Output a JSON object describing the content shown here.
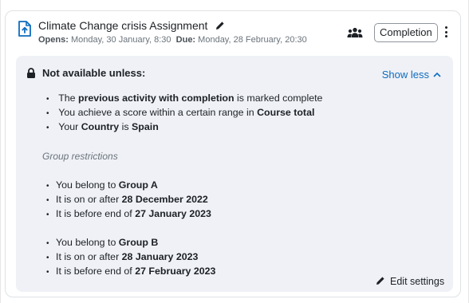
{
  "activity": {
    "title": "Climate Change crisis Assignment",
    "opens_label": "Opens:",
    "opens_value": "Monday, 30 January, 8:30",
    "due_label": "Due:",
    "due_value": "Monday, 28 February, 20:30",
    "icons": {
      "activity": "assignment-upload-icon",
      "edit": "pencil-icon",
      "group": "group-icon",
      "menu": "kebab-menu-icon"
    },
    "completion_label": "Completion"
  },
  "restrictions": {
    "title": "Not available unless:",
    "toggle_label": "Show less",
    "items": [
      {
        "pre": "The ",
        "bold": "previous activity with completion",
        "post": " is marked complete"
      },
      {
        "pre": "You achieve a score within a certain range in ",
        "bold": "Course total",
        "post": ""
      },
      {
        "pre": "Your ",
        "bold": "Country",
        "mid": " is ",
        "bold2": "Spain"
      }
    ],
    "group_heading": "Group restrictions",
    "groups": [
      {
        "items": [
          {
            "pre": "You belong to ",
            "bold": "Group A"
          },
          {
            "pre": "It is on or after ",
            "bold": "28 December 2022"
          },
          {
            "pre": "It is before end of ",
            "bold": "27 January 2023"
          }
        ]
      },
      {
        "items": [
          {
            "pre": "You belong to ",
            "bold": "Group B"
          },
          {
            "pre": "It is on or after ",
            "bold": "28 January 2023"
          },
          {
            "pre": "It is before end of ",
            "bold": "27 February 2023"
          }
        ]
      }
    ],
    "edit_label": "Edit settings"
  },
  "colors": {
    "link": "#0f6cbf",
    "panel_bg": "#eff1f6",
    "text": "#1d2125",
    "muted": "#6a737b"
  }
}
